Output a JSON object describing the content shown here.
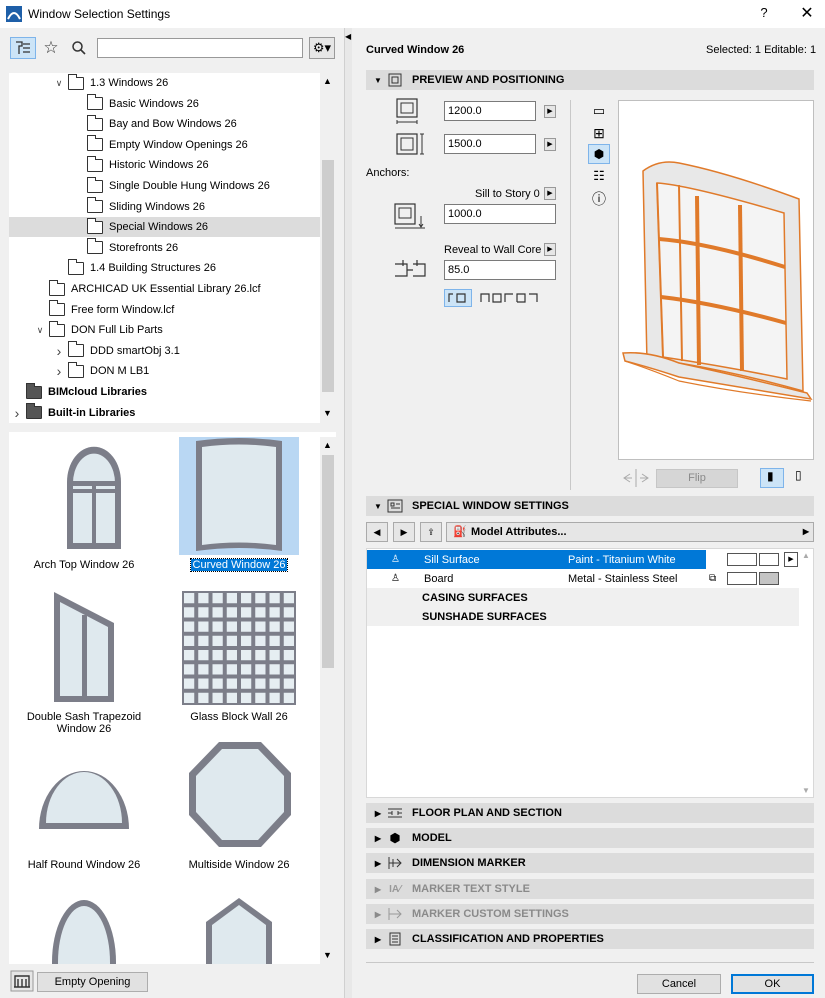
{
  "window": {
    "title": "Window Selection Settings",
    "help": "?",
    "close": "✕"
  },
  "left": {
    "search": {
      "value": "",
      "placeholder": ""
    },
    "tree": [
      {
        "label": "1.3 Windows 26",
        "indent": 2,
        "expanded": true
      },
      {
        "label": "Basic Windows 26",
        "indent": 3
      },
      {
        "label": "Bay and Bow Windows 26",
        "indent": 3
      },
      {
        "label": "Empty Window Openings 26",
        "indent": 3
      },
      {
        "label": "Historic Windows 26",
        "indent": 3
      },
      {
        "label": "Single Double Hung Windows 26",
        "indent": 3
      },
      {
        "label": "Sliding Windows 26",
        "indent": 3
      },
      {
        "label": "Special Windows 26",
        "indent": 3,
        "selected": true
      },
      {
        "label": "Storefronts 26",
        "indent": 3
      },
      {
        "label": "1.4 Building Structures 26",
        "indent": 2
      },
      {
        "label": "ARCHICAD UK Essential Library 26.lcf",
        "indent": 1
      },
      {
        "label": "Free form Window.lcf",
        "indent": 1
      },
      {
        "label": "DON Full Lib Parts",
        "indent": 1,
        "expanded": true
      },
      {
        "label": "DDD smartObj 3.1",
        "indent": 2,
        "collapsed": true
      },
      {
        "label": "DON  M LB1",
        "indent": 2,
        "collapsed": true
      },
      {
        "label": "BIMcloud Libraries",
        "indent": 0,
        "bold": true
      },
      {
        "label": "Built-in Libraries",
        "indent": 0,
        "bold": true,
        "collapsed": true
      }
    ],
    "gallery": [
      {
        "label": "Arch Top Window 26"
      },
      {
        "label": "Curved Window 26",
        "selected": true
      },
      {
        "label": "Double Sash Trapezoid Window 26"
      },
      {
        "label": "Glass Block Wall 26"
      },
      {
        "label": "Half Round Window 26"
      },
      {
        "label": "Multiside Window 26"
      }
    ],
    "empty_opening_label": "Empty Opening"
  },
  "right": {
    "object_name": "Curved Window 26",
    "selected_info": "Selected: 1 Editable: 1",
    "preview_section": "PREVIEW AND POSITIONING",
    "width_value": "1200.0",
    "height_value": "1500.0",
    "anchors_label": "Anchors:",
    "sill_label": "Sill to Story 0",
    "sill_value": "1000.0",
    "reveal_label": "Reveal to Wall Core",
    "reveal_value": "85.0",
    "flip_label": "Flip",
    "special_section": "SPECIAL WINDOW SETTINGS",
    "model_attributes": "Model Attributes...",
    "attributes": [
      {
        "name": "Sill Surface",
        "value": "Paint - Titanium White",
        "selected": true
      },
      {
        "name": "Board",
        "value": "Metal - Stainless Steel"
      },
      {
        "name": "CASING SURFACES",
        "value": "",
        "group": true
      },
      {
        "name": "SUNSHADE SURFACES",
        "value": "",
        "group": true
      }
    ],
    "sections": [
      {
        "label": "FLOOR PLAN AND SECTION",
        "enabled": true
      },
      {
        "label": "MODEL",
        "enabled": true
      },
      {
        "label": "DIMENSION MARKER",
        "enabled": true
      },
      {
        "label": "MARKER TEXT STYLE",
        "enabled": false
      },
      {
        "label": "MARKER CUSTOM SETTINGS",
        "enabled": false
      },
      {
        "label": "CLASSIFICATION AND PROPERTIES",
        "enabled": true
      }
    ],
    "cancel_label": "Cancel",
    "ok_label": "OK"
  },
  "colors": {
    "selection_blue": "#0078d7",
    "frame_orange": "#e07a2a",
    "window_frame_gray": "#7c7e89"
  }
}
